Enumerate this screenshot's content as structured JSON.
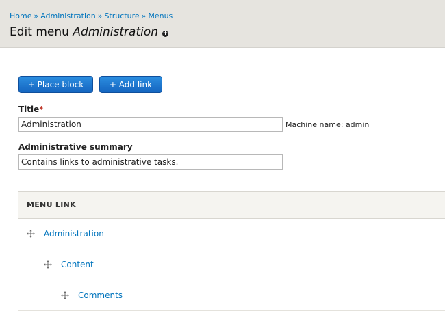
{
  "breadcrumb": {
    "items": [
      "Home",
      "Administration",
      "Structure",
      "Menus"
    ],
    "separator": "»"
  },
  "page": {
    "title_prefix": "Edit menu",
    "title_name": "Administration"
  },
  "buttons": {
    "place_block": "+ Place block",
    "add_link": "+ Add link"
  },
  "form": {
    "title_label": "Title",
    "required_mark": "*",
    "title_value": "Administration",
    "machine_name": "Machine name: admin",
    "summary_label": "Administrative summary",
    "summary_value": "Contains links to administrative tasks."
  },
  "table": {
    "header": "MENU LINK",
    "rows": [
      {
        "label": "Administration"
      },
      {
        "label": "Content"
      },
      {
        "label": "Comments"
      }
    ]
  },
  "colors": {
    "link": "#0074bd",
    "button": "#1f7bd6",
    "header_bg": "#e6e4df"
  }
}
